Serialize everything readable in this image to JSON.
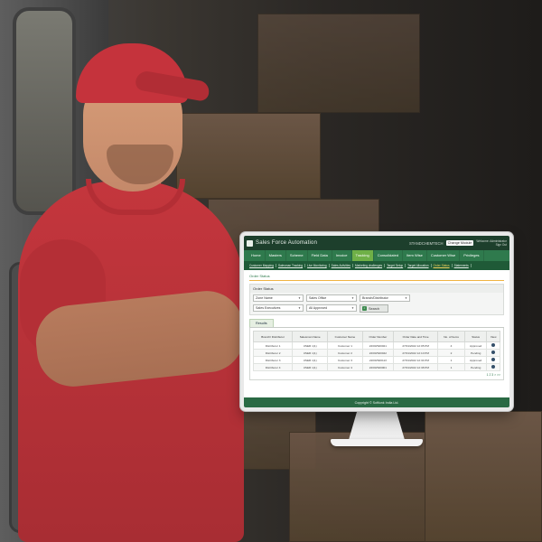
{
  "app": {
    "title": "Sales Force Automation",
    "user_info": "STANDCHEMTECH",
    "change_module": "Change Module",
    "top_links": [
      "Welcome: Administrator",
      "Sign Out"
    ]
  },
  "nav": {
    "items": [
      "Home",
      "Masters",
      "Scheme",
      "Field Data",
      "Invoice",
      "Tracking",
      "Consolidated",
      "Item Wise",
      "Customer Wise",
      "Privileges"
    ],
    "active": "Tracking"
  },
  "subnav": {
    "items": [
      "Customer Mapping",
      "Salesman Tracking",
      "Live Monitoring",
      "Sales Activities",
      "Marketing challenges",
      "Target Setup",
      "Target Allocation",
      "Order Status",
      "Statements"
    ],
    "active": "Order Status"
  },
  "breadcrumb": "Order Status",
  "panel": {
    "title": "Order Status",
    "filters": {
      "zone": "Zone Name",
      "sales_office": "Sales Office",
      "branch": "Branch/Distributor",
      "executive": "Sales Executives",
      "status": "All Approved"
    },
    "search_label": "Search"
  },
  "results": {
    "tab_label": "Results",
    "columns": [
      "Branch/ Distributor",
      "Salesman Name",
      "Customer Name",
      "Order Number",
      "Order Date and Time",
      "No. of Items",
      "Status",
      "View"
    ],
    "rows": [
      [
        "Distributor 1",
        "USER 1(1)",
        "Customer 1",
        "22/00/S00021",
        "27/01/2022 12:05 PM",
        "4",
        "Approved"
      ],
      [
        "Distributor 2",
        "USER 1(1)",
        "Customer 2",
        "22/00/S00042",
        "27/01/2022 12:10 PM",
        "2",
        "Pending"
      ],
      [
        "Distributor 3",
        "USER 1(1)",
        "Customer 3",
        "22/00/S00113",
        "27/01/2022 12:34 PM",
        "1",
        "Approved"
      ],
      [
        "Distributor 4",
        "USER 1(1)",
        "Customer 4",
        "22/00/S00001",
        "27/01/2022 12:38 PM",
        "1",
        "Pending"
      ]
    ],
    "pager": "1 2 3 > >>"
  },
  "footer": "Copyright © Softlunk India Ltd."
}
